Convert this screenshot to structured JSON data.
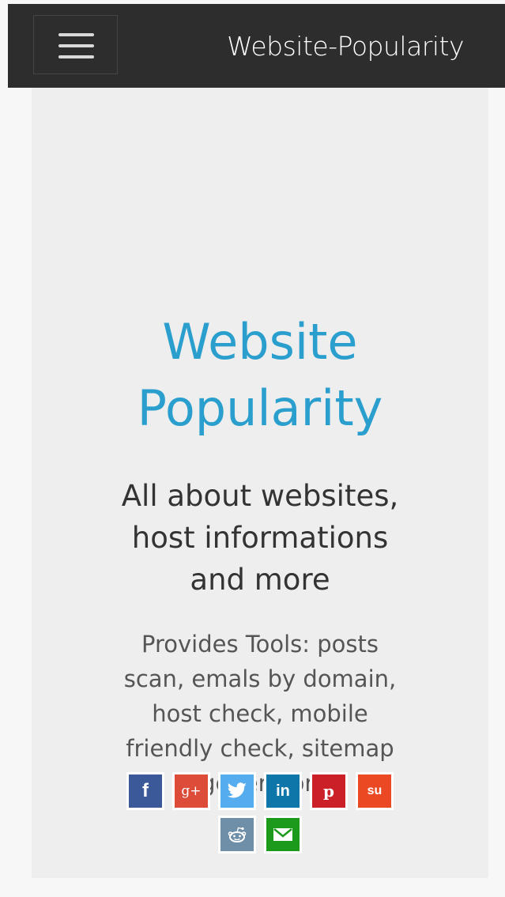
{
  "navbar": {
    "brand": "Website-Popularity",
    "menu_icon": "hamburger-menu-icon"
  },
  "hero": {
    "title_lines": [
      "Website",
      "Popularity"
    ],
    "tagline_lines": [
      "All about websites,",
      "host informations",
      "and more"
    ],
    "description_lines": [
      "Provides Tools: posts",
      "scan, emals by domain,",
      "host check, mobile",
      "friendly check, sitemap",
      "generator."
    ]
  },
  "share": {
    "buttons": [
      {
        "icon": "facebook-icon",
        "glyph": "f",
        "color": "#3b5998"
      },
      {
        "icon": "google-plus-icon",
        "glyph": "g+",
        "color": "#dd4b39"
      },
      {
        "icon": "twitter-icon",
        "glyph": "",
        "color": "#55acee"
      },
      {
        "icon": "linkedin-icon",
        "glyph": "in",
        "color": "#0e76a8"
      },
      {
        "icon": "pinterest-icon",
        "glyph": "p",
        "color": "#cb2027"
      },
      {
        "icon": "stumbleupon-icon",
        "glyph": "su",
        "color": "#eb4924"
      },
      {
        "icon": "reddit-icon",
        "glyph": "",
        "color": "#6f8ea8"
      },
      {
        "icon": "email-icon",
        "glyph": "",
        "color": "#1b9a1b"
      }
    ]
  },
  "colors": {
    "navbar_bg": "#2d2d2d",
    "panel_bg": "#eeeeee",
    "title": "#2a9fce"
  }
}
